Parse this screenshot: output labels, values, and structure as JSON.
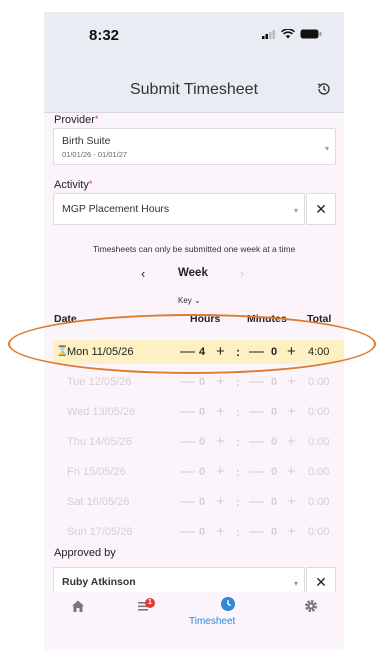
{
  "status_bar": {
    "time": "8:32"
  },
  "nav": {
    "title": "Submit Timesheet",
    "history_icon": "history-icon"
  },
  "provider": {
    "label": "Provider",
    "required_mark": "*",
    "value": "Birth Suite",
    "sub": "01/01/26 - 01/01/27"
  },
  "activity": {
    "label": "Activity",
    "required_mark": "*",
    "value": "MGP Placement Hours",
    "clear": "✕"
  },
  "note": "Timesheets can only be submitted one week at a time",
  "week": {
    "prev": "‹",
    "label": "Week",
    "next": "›"
  },
  "key_label": "Key ⌄",
  "table": {
    "headers": {
      "date": "Date",
      "hours": "Hours",
      "minutes": "Minutes",
      "total": "Total"
    },
    "rows": [
      {
        "date": "Mon 11/05/26",
        "hours": "4",
        "minutes": "0",
        "total": "4:00",
        "active": true
      },
      {
        "date": "Tue 12/05/26",
        "hours": "0",
        "minutes": "0",
        "total": "0:00"
      },
      {
        "date": "Wed 13/05/26",
        "hours": "0",
        "minutes": "0",
        "total": "0:00"
      },
      {
        "date": "Thu 14/05/26",
        "hours": "0",
        "minutes": "0",
        "total": "0:00"
      },
      {
        "date": "Fri  15/05/26",
        "hours": "0",
        "minutes": "0",
        "total": "0:00"
      },
      {
        "date": "Sat  16/05/26",
        "hours": "0",
        "minutes": "0",
        "total": "0:00"
      },
      {
        "date": "Sun  17/05/26",
        "hours": "0",
        "minutes": "0",
        "total": "0:00"
      }
    ],
    "minus": "—",
    "plus": "+",
    "colon": ":"
  },
  "approved": {
    "label": "Approved by",
    "value": "Ruby Atkinson",
    "clear": "✕"
  },
  "tabbar": {
    "active_label": "Timesheet",
    "badge": "1"
  },
  "colors": {
    "accent": "#2b8ad6",
    "highlight_row": "#fdf0c2",
    "annotation": "#e07a2e",
    "badge": "#e53935"
  }
}
